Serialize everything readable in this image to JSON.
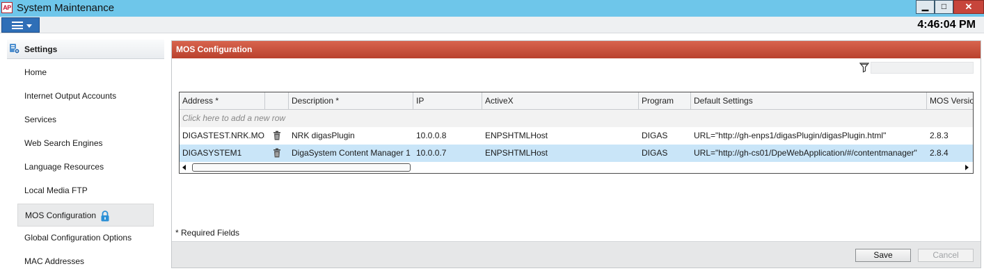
{
  "window": {
    "app_icon_text": "AP",
    "title": "System Maintenance",
    "minimize_glyph": "▁",
    "maximize_glyph": "□",
    "close_glyph": "✕"
  },
  "toolbar": {
    "menu_icon": "hamburger-menu-icon",
    "clock": "4:46:04 PM"
  },
  "sidebar": {
    "header": "Settings",
    "active_item": "MOS Configuration",
    "items": [
      {
        "label": "Home"
      },
      {
        "label": "Internet Output Accounts"
      },
      {
        "label": "Services"
      },
      {
        "label": "Web Search Engines"
      },
      {
        "label": "Language Resources"
      },
      {
        "label": "Local Media FTP"
      },
      {
        "label": "MOS Configuration",
        "locked": true
      },
      {
        "label": "Global Configuration Options"
      },
      {
        "label": "MAC Addresses"
      }
    ]
  },
  "panel": {
    "title": "MOS Configuration",
    "header_color": "#c24a35",
    "filter_icon": "filter-icon",
    "filter_value": "",
    "columns": [
      "Address *",
      "",
      "Description *",
      "IP",
      "ActiveX",
      "Program",
      "Default Settings",
      "MOS Versio"
    ],
    "add_row_hint": "Click here to add a new row",
    "rows": [
      {
        "address": "DIGASTEST.NRK.MOS",
        "description": "NRK digasPlugin",
        "ip": "10.0.0.8",
        "activex": "ENPSHTMLHost",
        "program": "DIGAS",
        "default_settings": "URL=\"http://gh-enps1/digasPlugin/digasPlugin.html\"",
        "mos_version": "2.8.3",
        "selected": false
      },
      {
        "address": "DIGASYSTEM1",
        "description": "DigaSystem Content Manager 1",
        "ip": "10.0.0.7",
        "activex": "ENPSHTMLHost",
        "program": "DIGAS",
        "default_settings": "URL=\"http://gh-cs01/DpeWebApplication/#/contentmanager\"",
        "mos_version": "2.8.4",
        "selected": true
      }
    ],
    "selected_row_color": "#c9e5f8",
    "required_note": "* Required Fields",
    "save_label": "Save",
    "cancel_label": "Cancel",
    "cancel_enabled": false
  }
}
